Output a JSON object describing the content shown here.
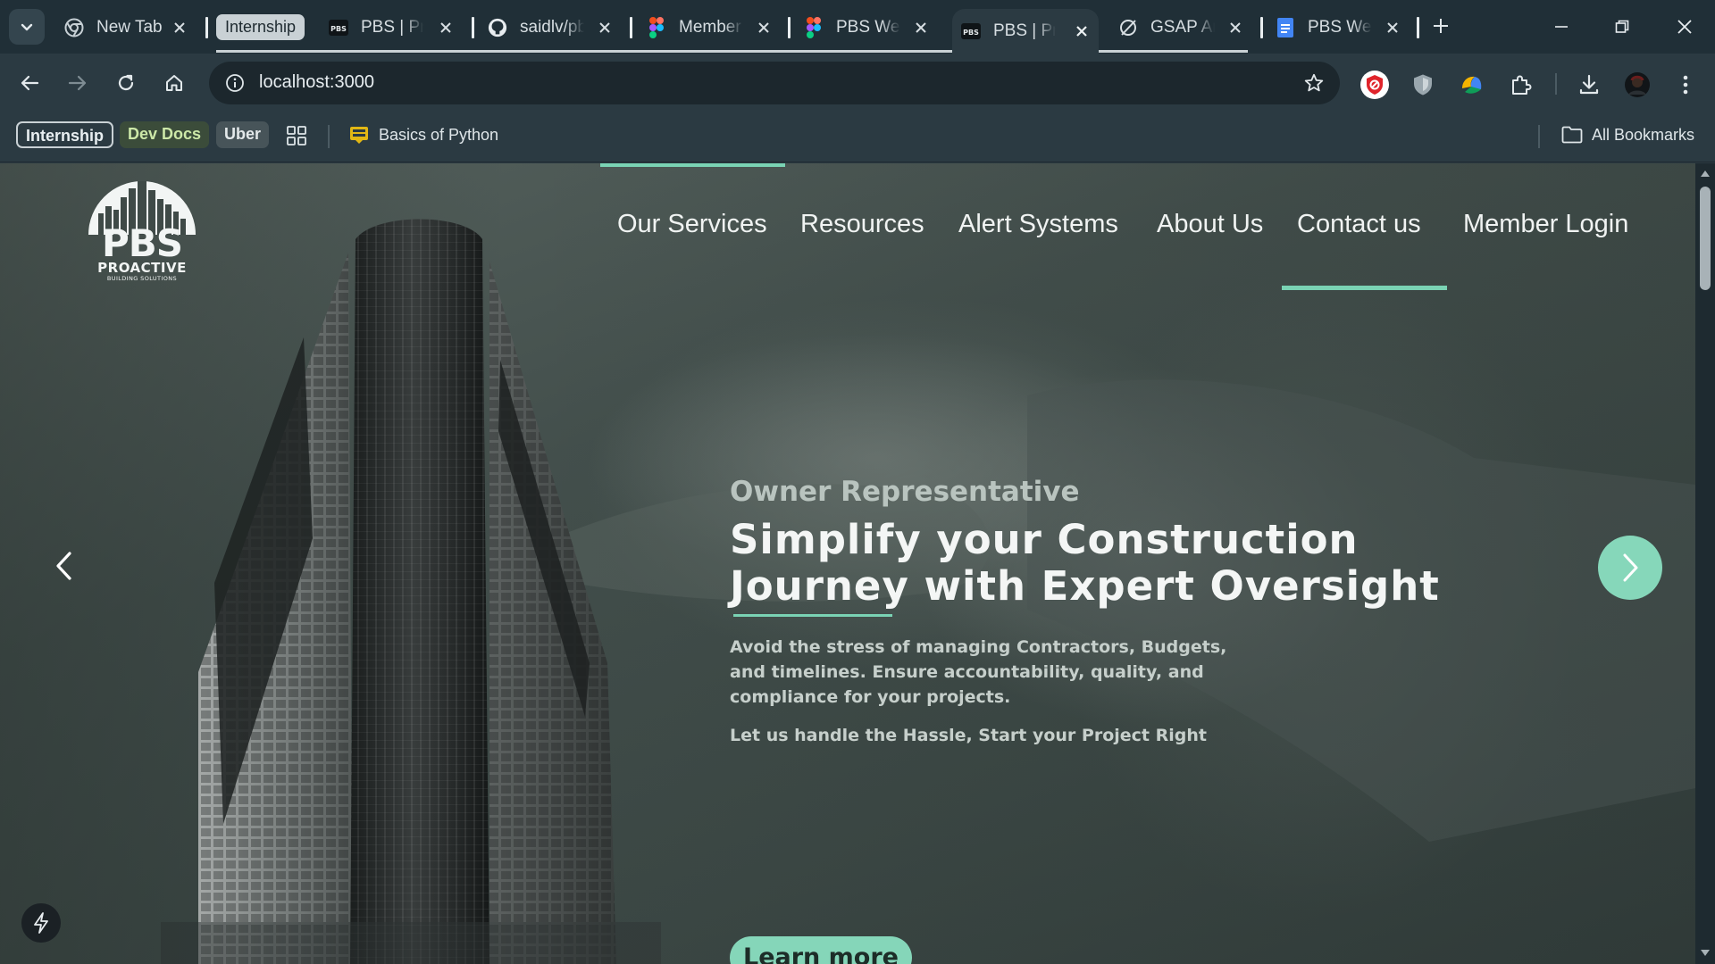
{
  "browser": {
    "tabs": [
      {
        "title": "New Tab",
        "icon": "chrome-icon",
        "active": false
      },
      {
        "title": "PBS | Pro",
        "icon": "pbs-logo-icon",
        "active": false
      },
      {
        "title": "saidlv/pb",
        "icon": "github-icon",
        "active": false
      },
      {
        "title": "Member",
        "icon": "figma-icon",
        "active": false
      },
      {
        "title": "PBS Web",
        "icon": "figma-icon",
        "active": false
      },
      {
        "title": "PBS | Pro",
        "icon": "pbs-logo-icon",
        "active": true
      },
      {
        "title": "GSAP An",
        "icon": "gsap-icon",
        "active": false
      },
      {
        "title": "PBS Web",
        "icon": "google-docs-icon",
        "active": false
      }
    ],
    "tab_group_label": "Internship",
    "address": "localhost:3000",
    "bookmarks": {
      "chips": [
        "Internship",
        "Dev Docs",
        "Uber"
      ],
      "items": [
        {
          "label": "Basics of Python",
          "icon": "course-icon"
        }
      ],
      "all_bookmarks": "All Bookmarks"
    },
    "colors": {
      "chrome_bg": "#202f37",
      "toolbar_bg": "#2b3a42",
      "accent": "#7ad3b4"
    }
  },
  "page": {
    "logo": {
      "main": "PBS",
      "sub": "PROACTIVE",
      "sub2": "BUILDING SOLUTIONS"
    },
    "nav": [
      "Our Services",
      "Resources",
      "Alert Systems",
      "About Us",
      "Contact us",
      "Member Login"
    ],
    "hero": {
      "eyebrow": "Owner Representative",
      "headline_line1": "Simplify your Construction",
      "headline_line2": "Journey with Expert Oversight",
      "body": "Avoid the stress of managing Contractors, Budgets, and timelines. Ensure accountability, quality, and compliance for your projects.",
      "tagline": "Let us handle the Hassle, Start your Project Right",
      "cta": "Learn more"
    },
    "colors": {
      "accent": "#85d6b9",
      "text": "#f4f6f5"
    }
  }
}
